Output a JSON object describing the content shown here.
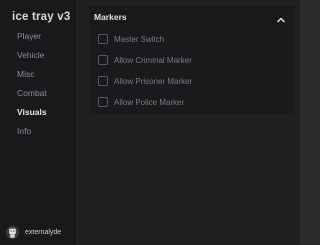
{
  "app": {
    "title": "ice tray v3"
  },
  "sidebar": {
    "items": [
      {
        "label": "Player",
        "active": false
      },
      {
        "label": "Vehicle",
        "active": false
      },
      {
        "label": "Misc",
        "active": false
      },
      {
        "label": "Combat",
        "active": false
      },
      {
        "label": "Visuals",
        "active": true
      },
      {
        "label": "Info",
        "active": false
      }
    ],
    "user": {
      "name": "externalyde",
      "avatar_icon": "user-avatar-icon"
    }
  },
  "panel": {
    "title": "Markers",
    "collapse_icon": "chevron-up-icon",
    "options": [
      {
        "label": "Master Switch",
        "checked": false
      },
      {
        "label": "Allow Criminal Marker",
        "checked": false
      },
      {
        "label": "Allow Prisoner Marker",
        "checked": false
      },
      {
        "label": "Allow Police Marker",
        "checked": false
      }
    ]
  },
  "colors": {
    "background": "#1e1e20",
    "sidebar": "#19191b",
    "panel": "#1a1a1c",
    "text_active": "#e6e6e6",
    "text_muted": "#8e8e93"
  }
}
